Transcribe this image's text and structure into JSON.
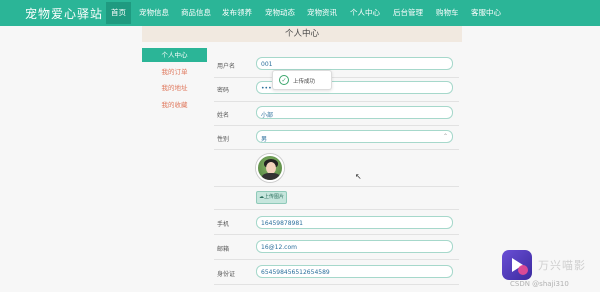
{
  "nav": {
    "brand": "宠物爱心驿站",
    "items": [
      "首页",
      "宠物信息",
      "商品信息",
      "发布领养",
      "宠物动态",
      "宠物资讯",
      "个人中心",
      "后台管理",
      "购物车",
      "客服中心"
    ]
  },
  "header": {
    "title": "个人中心"
  },
  "sidebar": {
    "items": [
      "个人中心",
      "我的订单",
      "我的地址",
      "我的收藏"
    ]
  },
  "form": {
    "username": {
      "label": "用户名",
      "value": "001"
    },
    "password": {
      "label": "密码",
      "value": "•••"
    },
    "name": {
      "label": "姓名",
      "value": "小部"
    },
    "gender": {
      "label": "性别",
      "value": "男"
    },
    "upload_label": "上传图片",
    "phone": {
      "label": "手机",
      "value": "16459878981"
    },
    "email": {
      "label": "邮箱",
      "value": "16@12.com"
    },
    "id_card": {
      "label": "身份证",
      "value": "654598456512654589"
    }
  },
  "toast": {
    "message": "上传成功"
  },
  "watermark": {
    "app": "万兴喵影",
    "csdn": "CSDN @shaji310"
  },
  "colors": {
    "accent": "#2bb597",
    "sidebar_text": "#e07a5f",
    "banner": "#f1e9e0"
  }
}
